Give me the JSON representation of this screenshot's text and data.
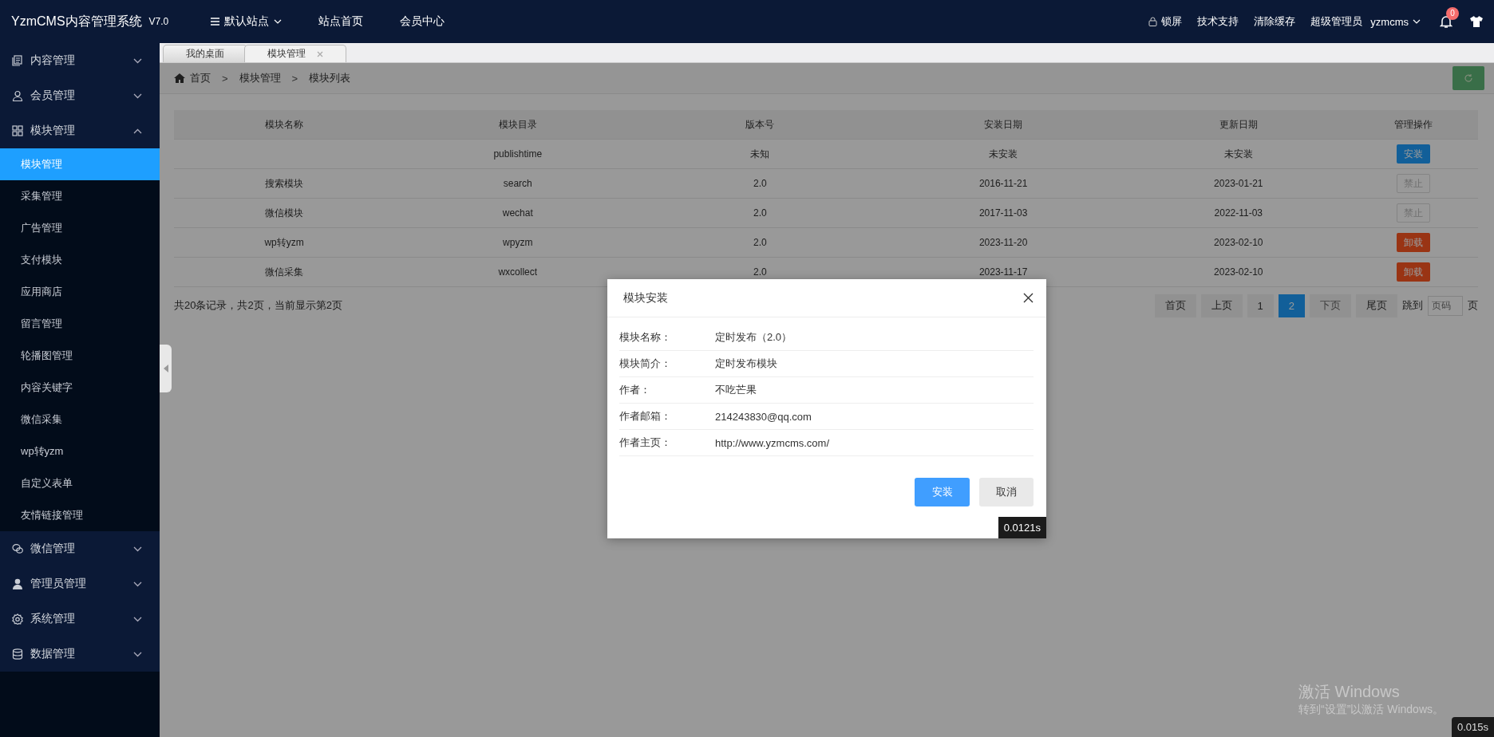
{
  "header": {
    "logo": "YzmCMS内容管理系统",
    "version": "V7.0",
    "site_menu": "默认站点",
    "nav": [
      "站点首页",
      "会员中心"
    ],
    "lock": "锁屏",
    "links": [
      "技术支持",
      "清除缓存",
      "超级管理员"
    ],
    "user": "yzmcms",
    "notifications": "0"
  },
  "sidebar": [
    {
      "label": "内容管理",
      "expanded": false
    },
    {
      "label": "会员管理",
      "expanded": false
    },
    {
      "label": "模块管理",
      "expanded": true,
      "children": [
        {
          "label": "模块管理",
          "selected": true
        },
        {
          "label": "采集管理",
          "selected": false
        },
        {
          "label": "广告管理",
          "selected": false
        },
        {
          "label": "支付模块",
          "selected": false
        },
        {
          "label": "应用商店",
          "selected": false
        },
        {
          "label": "留言管理",
          "selected": false
        },
        {
          "label": "轮播图管理",
          "selected": false
        },
        {
          "label": "内容关键字",
          "selected": false
        },
        {
          "label": "微信采集",
          "selected": false
        },
        {
          "label": "wp转yzm",
          "selected": false
        },
        {
          "label": "自定义表单",
          "selected": false
        },
        {
          "label": "友情链接管理",
          "selected": false
        }
      ]
    },
    {
      "label": "微信管理",
      "expanded": false
    },
    {
      "label": "管理员管理",
      "expanded": false
    },
    {
      "label": "系统管理",
      "expanded": false
    },
    {
      "label": "数据管理",
      "expanded": false
    }
  ],
  "tabs": [
    {
      "label": "我的桌面",
      "selected": false,
      "closable": false
    },
    {
      "label": "模块管理",
      "selected": true,
      "closable": true
    }
  ],
  "breadcrumb": {
    "items": [
      "首页",
      "模块管理",
      "模块列表"
    ],
    "separator": ">"
  },
  "table": {
    "columns": [
      "模块名称",
      "模块目录",
      "版本号",
      "安装日期",
      "更新日期",
      "管理操作"
    ],
    "rows": [
      {
        "cells": [
          "",
          "publishtime",
          "未知",
          "未安装",
          "未安装"
        ],
        "action": {
          "label": "安装",
          "kind": "install"
        }
      },
      {
        "cells": [
          "搜索模块",
          "search",
          "2.0",
          "2016-11-21",
          "2023-01-21"
        ],
        "action": {
          "label": "禁止",
          "kind": "disabled"
        }
      },
      {
        "cells": [
          "微信模块",
          "wechat",
          "2.0",
          "2017-11-03",
          "2022-11-03"
        ],
        "action": {
          "label": "禁止",
          "kind": "disabled"
        }
      },
      {
        "cells": [
          "wp转yzm",
          "wpyzm",
          "2.0",
          "2023-11-20",
          "2023-02-10"
        ],
        "action": {
          "label": "卸载",
          "kind": "uninstall"
        }
      },
      {
        "cells": [
          "微信采集",
          "wxcollect",
          "2.0",
          "2023-11-17",
          "2023-02-10"
        ],
        "action": {
          "label": "卸载",
          "kind": "uninstall"
        }
      }
    ]
  },
  "summary": "共20条记录，共2页，当前显示第2页",
  "pagination": {
    "pages": [
      {
        "label": "首页",
        "selected": false,
        "disabled": false
      },
      {
        "label": "上页",
        "selected": false,
        "disabled": false
      },
      {
        "label": "1",
        "selected": false,
        "disabled": false
      },
      {
        "label": "2",
        "selected": true,
        "disabled": false
      },
      {
        "label": "下页",
        "selected": false,
        "disabled": true
      },
      {
        "label": "尾页",
        "selected": false,
        "disabled": false
      }
    ],
    "jump_label": "跳到",
    "jump_placeholder": "页码",
    "jump_suffix": "页"
  },
  "modal": {
    "title": "模块安装",
    "fields": [
      {
        "label": "模块名称：",
        "value": "定时发布（2.0）"
      },
      {
        "label": "模块简介：",
        "value": "定时发布模块"
      },
      {
        "label": "作者：",
        "value": "不吃芒果"
      },
      {
        "label": "作者邮箱：",
        "value": "214243830@qq.com"
      },
      {
        "label": "作者主页：",
        "value": "http://www.yzmcms.com/"
      }
    ],
    "buttons": [
      {
        "label": "安装",
        "kind": "primary"
      },
      {
        "label": "取消",
        "kind": "secondary"
      }
    ],
    "timing": "0.0121s"
  },
  "page_timing": "0.015s",
  "os_notice": {
    "title": "激活 Windows",
    "text": "转到“设置”以激活 Windows。"
  }
}
